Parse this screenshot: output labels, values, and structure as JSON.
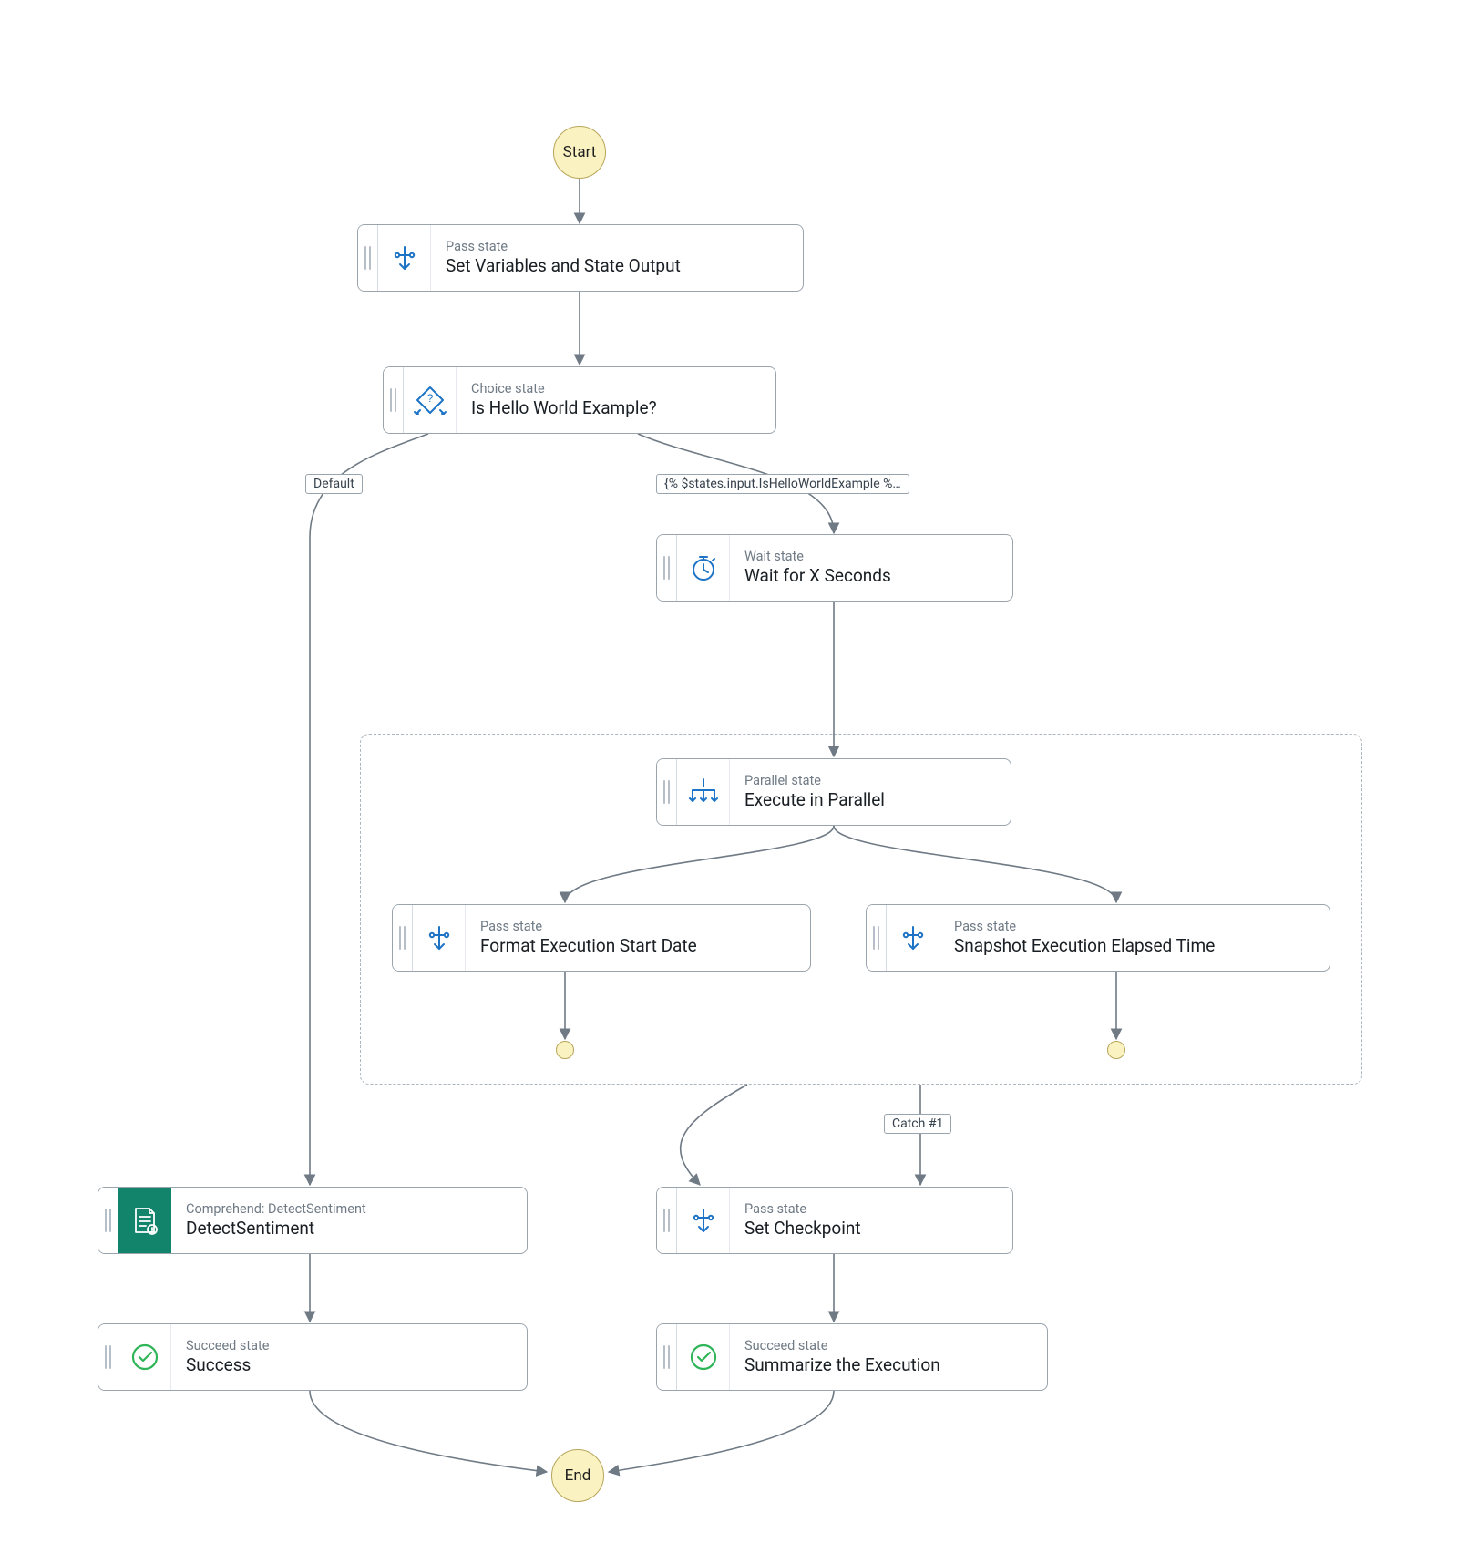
{
  "terminals": {
    "start": "Start",
    "end": "End"
  },
  "edgeLabels": {
    "default": "Default",
    "choiceTrue": "{% $states.input.IsHelloWorldExample %…",
    "catch1": "Catch #1"
  },
  "nodes": {
    "setVars": {
      "type": "Pass state",
      "title": "Set Variables and State Output"
    },
    "choice": {
      "type": "Choice state",
      "title": "Is Hello World Example?"
    },
    "wait": {
      "type": "Wait state",
      "title": "Wait for X Seconds"
    },
    "parallel": {
      "type": "Parallel state",
      "title": "Execute in Parallel"
    },
    "branchA": {
      "type": "Pass state",
      "title": "Format Execution Start Date"
    },
    "branchB": {
      "type": "Pass state",
      "title": "Snapshot Execution Elapsed Time"
    },
    "detect": {
      "type": "Comprehend: DetectSentiment",
      "title": "DetectSentiment"
    },
    "checkpoint": {
      "type": "Pass state",
      "title": "Set Checkpoint"
    },
    "successLeft": {
      "type": "Succeed state",
      "title": "Success"
    },
    "successRight": {
      "type": "Succeed state",
      "title": "Summarize the Execution"
    }
  }
}
